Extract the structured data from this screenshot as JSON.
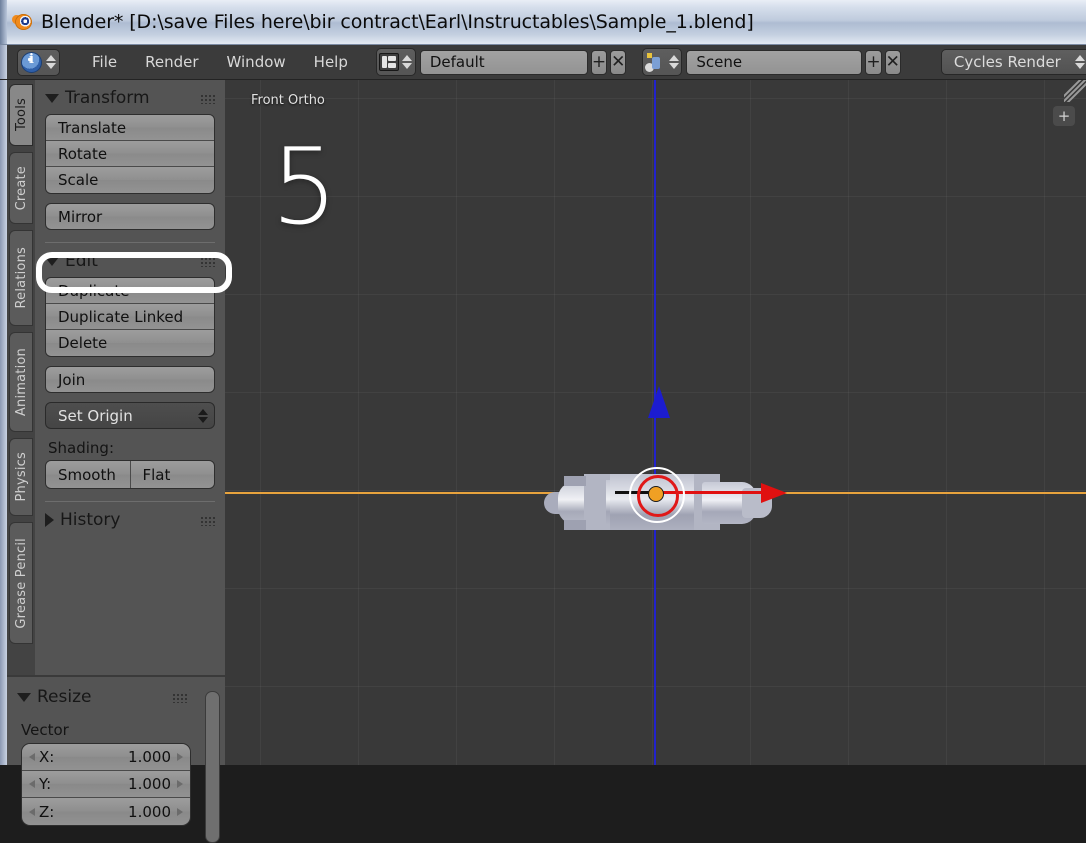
{
  "window": {
    "title": "Blender* [D:\\save Files here\\bir contract\\Earl\\Instructables\\Sample_1.blend]",
    "app_icon": "blender-logo-icon"
  },
  "topbar": {
    "editor_icon": "info-editor-icon",
    "menus": [
      {
        "label": "File"
      },
      {
        "label": "Render"
      },
      {
        "label": "Window"
      },
      {
        "label": "Help"
      }
    ],
    "screen_icon": "screen-layout-icon",
    "layout_value": "Default",
    "layout_add": "+",
    "layout_remove": "✕",
    "scene_icon": "scene-icon",
    "scene_value": "Scene",
    "scene_add": "+",
    "scene_remove": "✕",
    "render_engine": "Cycles Render",
    "wrench_icon": "wrench-icon"
  },
  "toolshelf": {
    "tabs": [
      {
        "label": "Tools",
        "active": true
      },
      {
        "label": "Create",
        "active": false
      },
      {
        "label": "Relations",
        "active": false
      },
      {
        "label": "Animation",
        "active": false
      },
      {
        "label": "Physics",
        "active": false
      },
      {
        "label": "Grease Pencil",
        "active": false
      }
    ],
    "transform_panel": {
      "title": "Transform",
      "expanded": true,
      "buttons": [
        {
          "label": "Translate"
        },
        {
          "label": "Rotate"
        },
        {
          "label": "Scale",
          "highlighted": true
        },
        {
          "label": "Mirror"
        }
      ]
    },
    "edit_panel": {
      "title": "Edit",
      "expanded": true,
      "buttons": [
        {
          "label": "Duplicate"
        },
        {
          "label": "Duplicate Linked"
        },
        {
          "label": "Delete"
        }
      ],
      "join_label": "Join",
      "set_origin_label": "Set Origin",
      "shading_label": "Shading:",
      "shading_options": [
        {
          "label": "Smooth"
        },
        {
          "label": "Flat"
        }
      ]
    },
    "history_panel": {
      "title": "History",
      "expanded": false
    }
  },
  "operator_panel": {
    "title": "Resize",
    "expanded": true,
    "vector_label": "Vector",
    "fields": [
      {
        "axis": "X:",
        "value": "1.000"
      },
      {
        "axis": "Y:",
        "value": "1.000"
      },
      {
        "axis": "Z:",
        "value": "1.000"
      }
    ]
  },
  "viewport": {
    "view_label": "Front Ortho",
    "step_number": "5",
    "panel_toggle": "+",
    "gizmo": {
      "x_axis_color": "#e01010",
      "z_axis_color": "#1c1cd0",
      "origin_color": "#f0a024",
      "ring_color": "#ffffff"
    },
    "grid_axis_x_color": "#e8a33d",
    "grid_axis_z_color": "#2222cc",
    "background_color": "#393939"
  }
}
